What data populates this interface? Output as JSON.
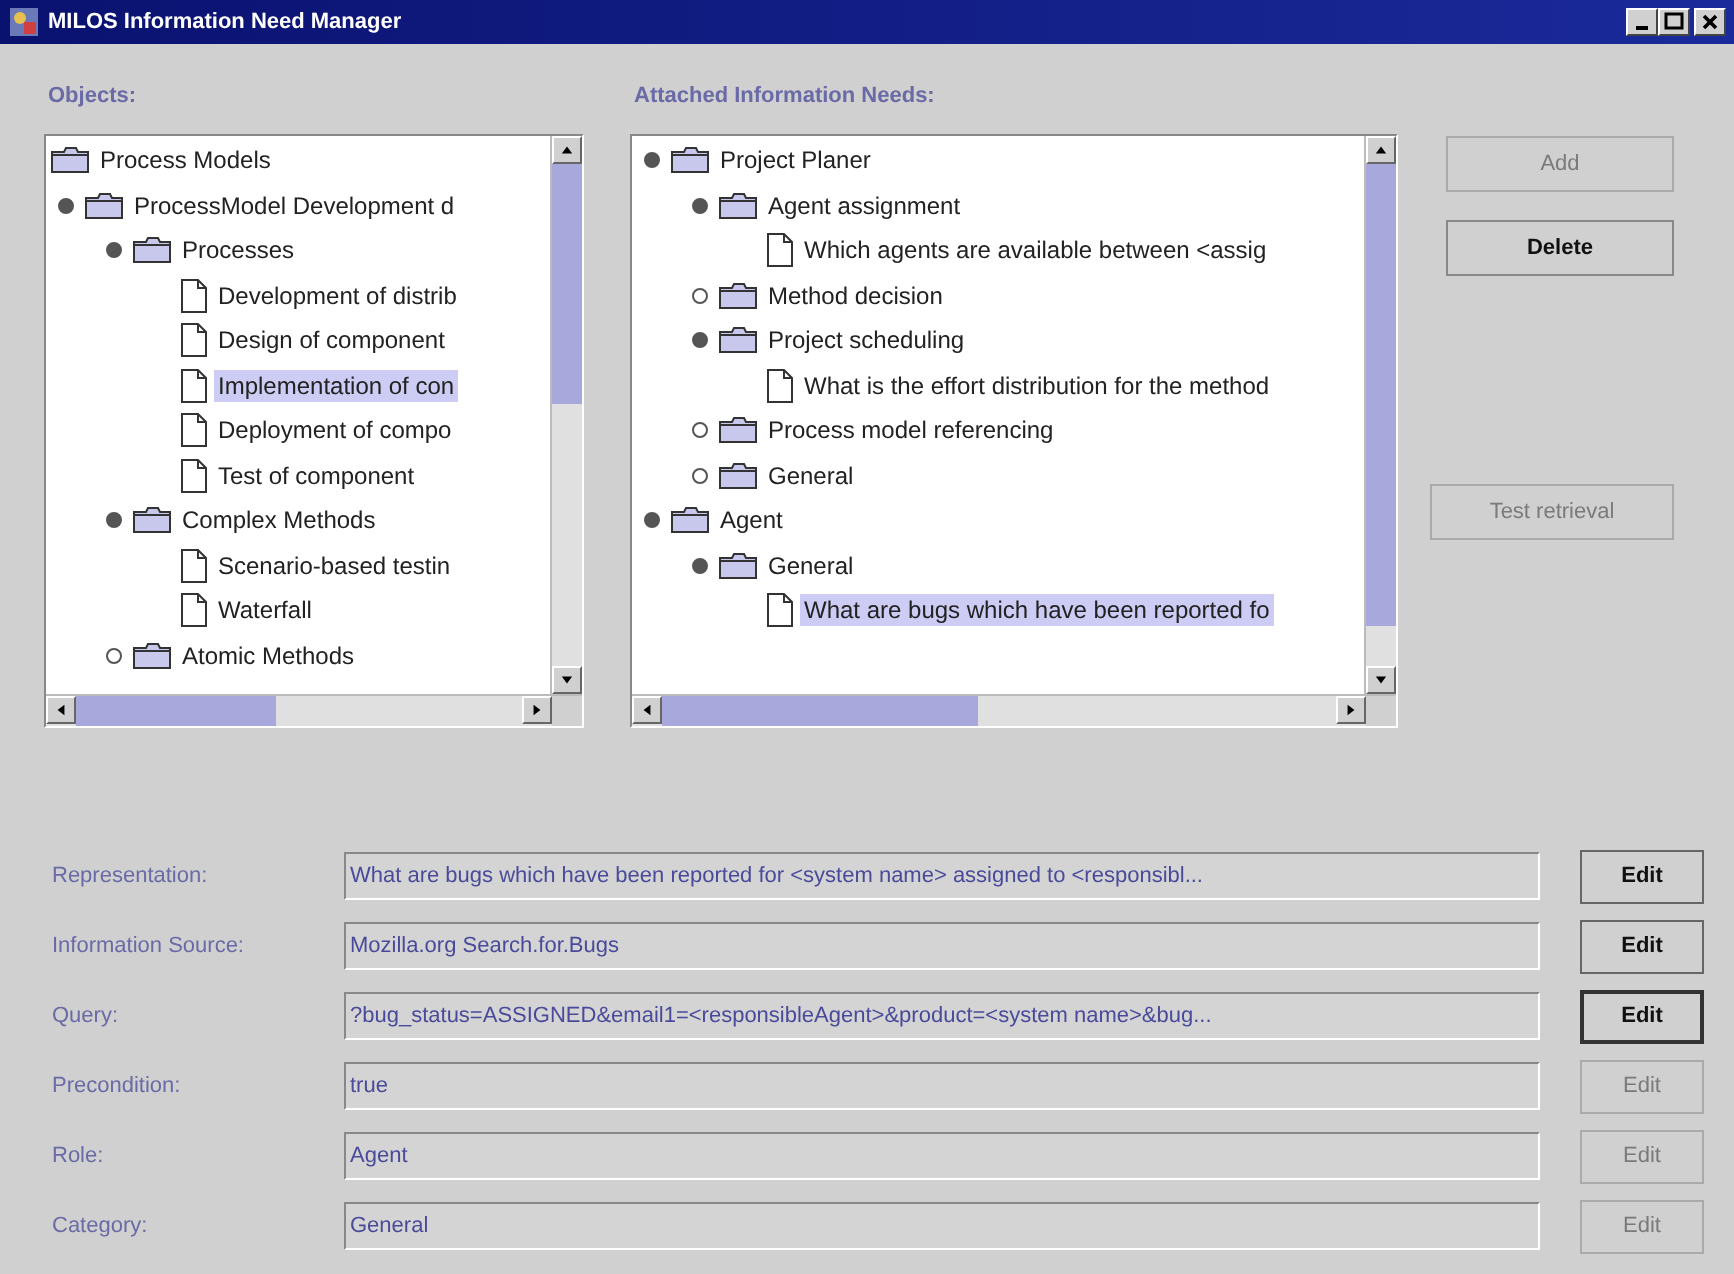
{
  "window": {
    "title": "MILOS Information Need Manager"
  },
  "objects": {
    "label": "Objects:",
    "root": {
      "label": "Process Models",
      "children": [
        {
          "label": "ProcessModel Development d",
          "kind": "folder",
          "expanded": true,
          "selected": false,
          "children": [
            {
              "label": "Processes",
              "kind": "folder",
              "expanded": true,
              "selected": false,
              "children": [
                {
                  "label": "Development of distrib",
                  "kind": "document",
                  "selected": false
                },
                {
                  "label": "Design of component",
                  "kind": "document",
                  "selected": false
                },
                {
                  "label": "Implementation of con",
                  "kind": "document",
                  "selected": true
                },
                {
                  "label": "Deployment of compo",
                  "kind": "document",
                  "selected": false
                },
                {
                  "label": "Test of component",
                  "kind": "document",
                  "selected": false
                }
              ]
            },
            {
              "label": "Complex Methods",
              "kind": "folder",
              "expanded": true,
              "selected": false,
              "children": [
                {
                  "label": "Scenario-based testin",
                  "kind": "document",
                  "selected": false
                },
                {
                  "label": "Waterfall",
                  "kind": "document",
                  "selected": false
                }
              ]
            },
            {
              "label": "Atomic Methods",
              "kind": "folder",
              "expanded": false,
              "selected": false
            }
          ]
        }
      ]
    }
  },
  "needs": {
    "label": "Attached Information Needs:",
    "items": [
      {
        "label": "Project Planer",
        "kind": "folder",
        "expanded": true,
        "selected": false,
        "children": [
          {
            "label": "Agent assignment",
            "kind": "folder",
            "expanded": true,
            "selected": false,
            "children": [
              {
                "label": "Which agents are available between <assig",
                "kind": "document",
                "selected": false
              }
            ]
          },
          {
            "label": "Method decision",
            "kind": "folder",
            "expanded": false,
            "selected": false
          },
          {
            "label": "Project scheduling",
            "kind": "folder",
            "expanded": true,
            "selected": false,
            "children": [
              {
                "label": "What is the effort distribution for the method",
                "kind": "document",
                "selected": false
              }
            ]
          },
          {
            "label": "Process model referencing",
            "kind": "folder",
            "expanded": false,
            "selected": false
          },
          {
            "label": "General",
            "kind": "folder",
            "expanded": false,
            "selected": false
          }
        ]
      },
      {
        "label": "Agent",
        "kind": "folder",
        "expanded": true,
        "selected": false,
        "children": [
          {
            "label": "General",
            "kind": "folder",
            "expanded": true,
            "selected": false,
            "children": [
              {
                "label": "What are bugs which have been reported fo",
                "kind": "document",
                "selected": true
              }
            ]
          }
        ]
      }
    ]
  },
  "actions": [
    {
      "label": "Add",
      "disabled": true
    },
    {
      "label": "Delete",
      "disabled": false
    },
    {
      "label": "Test retrieval",
      "disabled": true
    }
  ],
  "fields": [
    {
      "label": "Representation:",
      "value": "What are bugs which have been reported for <system name> assigned to <responsibl...",
      "edit": {
        "label": "Edit",
        "disabled": false,
        "focused": false
      }
    },
    {
      "label": "Information Source:",
      "value": "Mozilla.org Search.for.Bugs",
      "edit": {
        "label": "Edit",
        "disabled": false,
        "focused": false
      }
    },
    {
      "label": "Query:",
      "value": "?bug_status=ASSIGNED&email1=<responsibleAgent>&product=<system name>&bug...",
      "edit": {
        "label": "Edit",
        "disabled": false,
        "focused": true
      }
    },
    {
      "label": "Precondition:",
      "value": "true",
      "edit": {
        "label": "Edit",
        "disabled": true,
        "focused": false
      }
    },
    {
      "label": "Role:",
      "value": "Agent",
      "edit": {
        "label": "Edit",
        "disabled": true,
        "focused": false
      }
    },
    {
      "label": "Category:",
      "value": "General",
      "edit": {
        "label": "Edit",
        "disabled": true,
        "focused": false
      }
    }
  ]
}
